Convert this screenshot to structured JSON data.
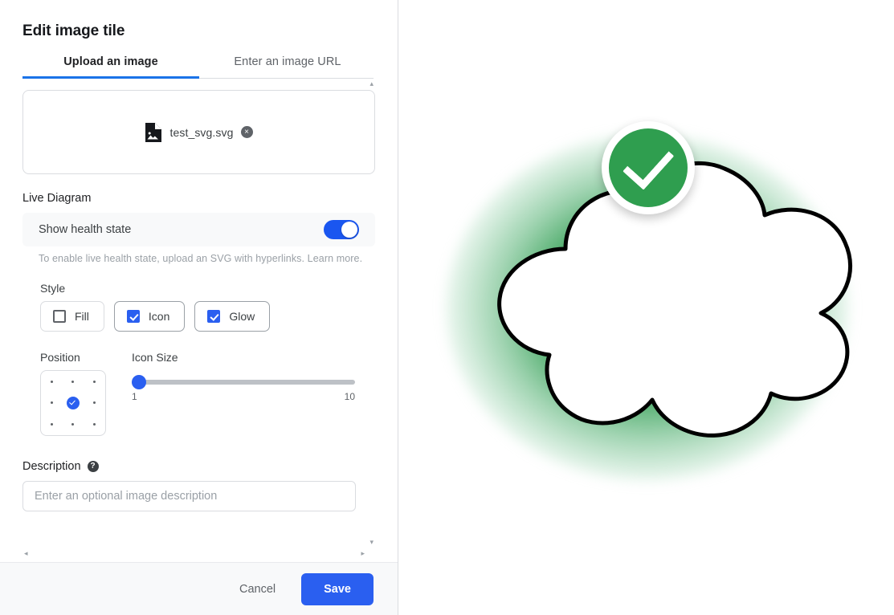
{
  "dialog": {
    "title": "Edit image tile"
  },
  "tabs": [
    {
      "label": "Upload an image",
      "active": true
    },
    {
      "label": "Enter an image URL",
      "active": false
    }
  ],
  "upload": {
    "file_name": "test_svg.svg",
    "file_icon": "image-file-icon",
    "remove_icon": "×"
  },
  "live_diagram": {
    "section_label": "Live Diagram",
    "toggle_label": "Show health state",
    "toggle_state": "on",
    "helper_text": "To enable live health state, upload an SVG with hyperlinks. Learn more."
  },
  "style": {
    "label": "Style",
    "options": [
      {
        "label": "Fill",
        "checked": false
      },
      {
        "label": "Icon",
        "checked": true
      },
      {
        "label": "Glow",
        "checked": true
      }
    ]
  },
  "position": {
    "label": "Position",
    "selected_index": 4,
    "cells": 9
  },
  "icon_size": {
    "label": "Icon Size",
    "value": 1,
    "min_label": "1",
    "max_label": "10"
  },
  "description": {
    "label": "Description",
    "help_icon": "?",
    "value": "",
    "placeholder": "Enter an optional image description"
  },
  "footer": {
    "cancel_label": "Cancel",
    "save_label": "Save"
  },
  "preview": {
    "shape": "cloud-diagram",
    "health_status": "healthy",
    "badge_icon": "check-circle-icon",
    "glow_color": "#2f9e4f",
    "badge_color": "#2f9e4f",
    "outline_color": "#000000"
  },
  "colors": {
    "accent_blue": "#2a5ff0",
    "tab_underline": "#1a73e8",
    "toggle_on": "#1a56f0",
    "health_green": "#2f9e4f",
    "footer_bg": "#f8f9fa",
    "border": "#dadce0"
  },
  "scroll": {
    "up_arrow": "▴",
    "down_arrow": "▾",
    "left_arrow": "◂",
    "right_arrow": "▸"
  }
}
